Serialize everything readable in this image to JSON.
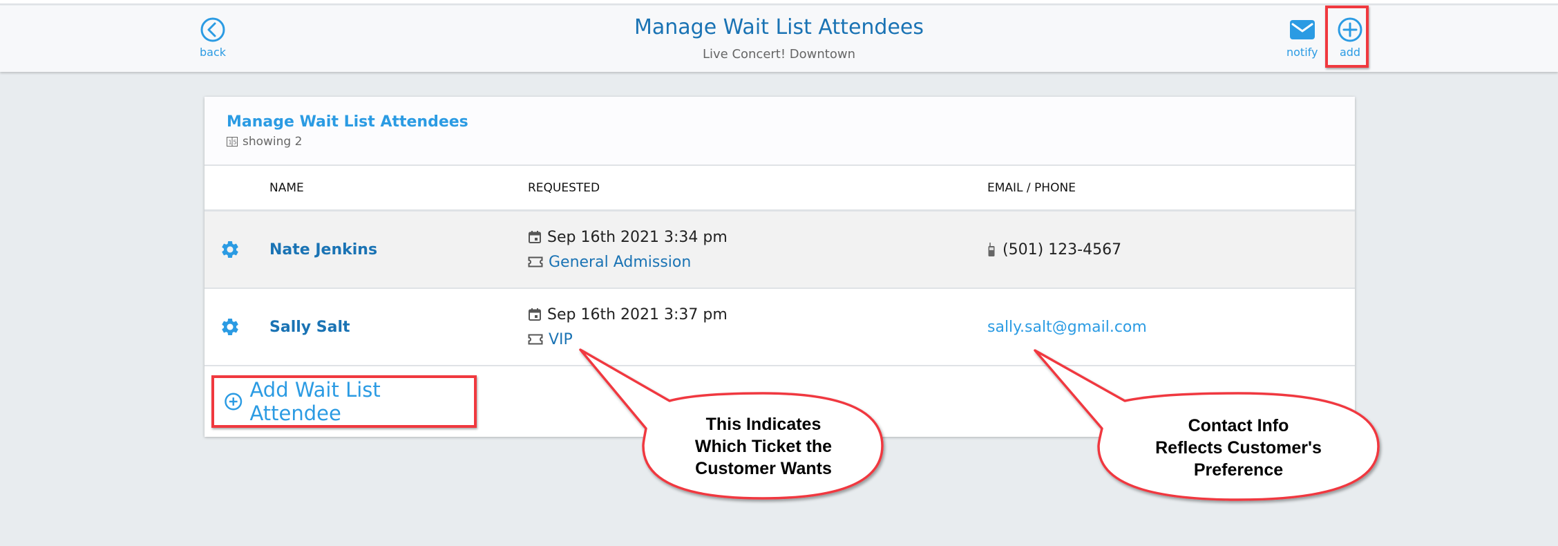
{
  "header": {
    "title": "Manage Wait List Attendees",
    "subtitle": "Live Concert! Downtown",
    "back_label": "back",
    "notify_label": "notify",
    "add_label": "add",
    "accent_color": "#2b9be3"
  },
  "card": {
    "title": "Manage Wait List Attendees",
    "count_label": "showing 2"
  },
  "table": {
    "columns": [
      "",
      "NAME",
      "REQUESTED",
      "EMAIL / PHONE"
    ],
    "rows": [
      {
        "name": "Nate Jenkins",
        "requested": "Sep 16th 2021 3:34 pm",
        "ticket": "General Admission",
        "contact_type": "phone",
        "contact": "(501) 123-4567"
      },
      {
        "name": "Sally Salt",
        "requested": "Sep 16th 2021 3:37 pm",
        "ticket": "VIP",
        "contact_type": "email",
        "contact": "sally.salt@gmail.com"
      }
    ]
  },
  "add_attendee_label": "Add Wait List Attendee",
  "annotations": [
    {
      "lines": [
        "This Indicates",
        "Which Ticket the",
        "Customer Wants"
      ]
    },
    {
      "lines": [
        "Contact Info",
        "Reflects Customer's",
        "Preference"
      ]
    }
  ],
  "annotation_color": "#f0393f"
}
